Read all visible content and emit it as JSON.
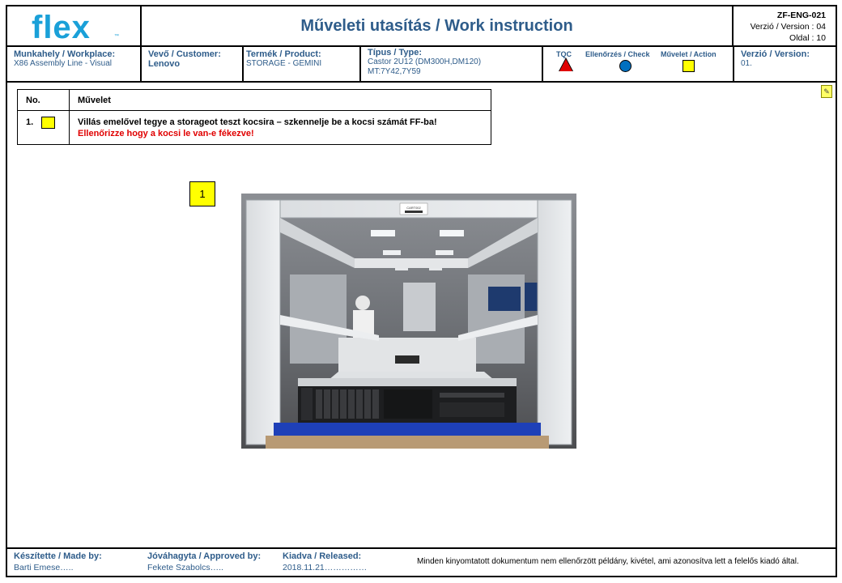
{
  "header": {
    "logo_text": "flex",
    "logo_tm": "™",
    "title": "Műveleti utasítás / Work instruction",
    "doc_code": "ZF-ENG-021",
    "version_line": "Verzió / Version :  04",
    "page_line": "Oldal : 10"
  },
  "info": {
    "workplace_label": "Munkahely / Workplace:",
    "workplace_value": "X86 Assembly Line - Visual",
    "customer_label": "Vevő / Customer:",
    "customer_value": "Lenovo",
    "product_label": "Termék / Product:",
    "product_value": "STORAGE  - GEMINI",
    "type_label": "Típus / Type:",
    "type_value_1": "Castor 2U12  (DM300H,DM120)",
    "type_value_2": "MT:7Y42,7Y59",
    "legend": {
      "tqc_label": "TQC",
      "check_label": "Ellenőrzés / Check",
      "action_label": "Művelet / Action",
      "tqc_color": "#e00000",
      "check_color": "#0070c0",
      "action_color": "#ffff00"
    },
    "version_label": "Verzió / Version:",
    "version_value": "01."
  },
  "operations": {
    "col_no": "No.",
    "col_op": "Művelet",
    "rows": [
      {
        "no": "1.",
        "main": "Villás emelővel tegye a storageot teszt kocsira – szkennelje be a kocsi számát FF-ba!",
        "warning": "Ellenőrizze hogy a kocsi le van-e fékezve!"
      }
    ]
  },
  "callout": {
    "number": "1"
  },
  "photo": {
    "cart_label": "CART002"
  },
  "footer": {
    "made_label": "Készítette / Made by:",
    "made_value": "Barti Emese…..",
    "approved_label": "Jóváhagyta / Approved by:",
    "approved_value": "Fekete Szabolcs…..",
    "released_label": "Kiadva / Released:",
    "released_value": "2018.11.21……………",
    "note": "Minden kinyomtatott dokumentum nem ellenőrzött példány, kivétel, ami azonosítva lett a felelős kiadó által."
  }
}
